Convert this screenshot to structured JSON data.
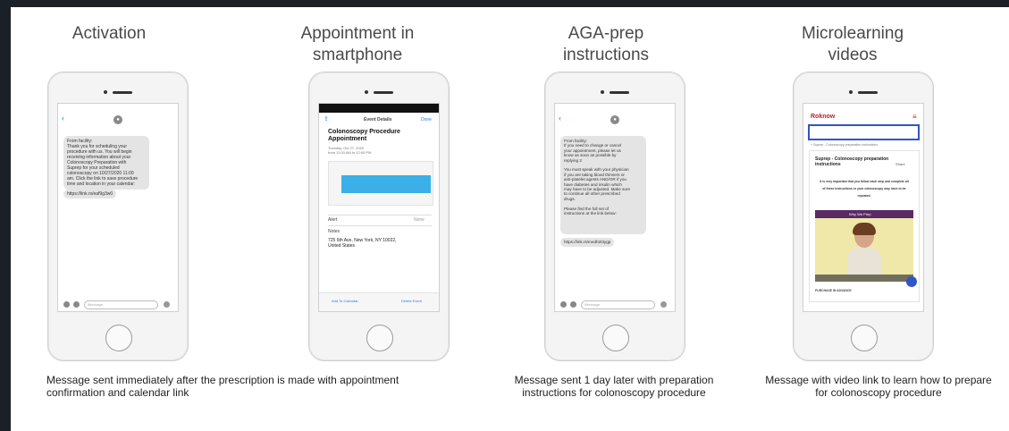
{
  "columns": [
    {
      "title": "Activation"
    },
    {
      "title": "Appointment in\nsmartphone"
    },
    {
      "title": "AGA-prep\ninstructions"
    },
    {
      "title": "Microlearning\nvideos"
    }
  ],
  "captions": {
    "left": "Message sent immediately after the prescription is made with appointment\nconfirmation and calendar link",
    "middle": "Message sent 1 day later with preparation\ninstructions for colonoscopy procedure",
    "right": "Message with video link to learn how to prepare\nfor colonoscopy procedure"
  },
  "phone1": {
    "message": "From facility:\nThank you for scheduling your\nprocedure with us. You will begin\nreceiving information about your\nColonoscopy Preparation with\nSuprep for your scheduled\ncolonoscopy on 10/27/2020 11:00\nam. Click the link to save procedure\ntime and location in your calendar:",
    "link": "https://link.rs/eaf9g3w0",
    "input_placeholder": "iMessage"
  },
  "phone2": {
    "nav_title": "Event Details",
    "nav_done": "Done",
    "event_title": "Colonoscopy Procedure\nAppointment",
    "event_meta": "Tuesday, Oct 27, 2020\nfrom 11:00 AM to 12:00 PM",
    "alert_label": "Alert",
    "alert_value": "None",
    "notes_label": "Notes",
    "notes_value": "725 6th Ave, New York, NY 10022,\nUnited States",
    "add_label": "Add To Calendar",
    "delete_label": "Delete Event",
    "event_color": "#3bb0e8"
  },
  "phone3": {
    "message": "From facility:\nIf you need to change or cancel\nyour appointment, please let us\nknow as soon as possible by\nreplying 2\n\nYou must speak with your physician\nif you are taking blood thinners or\nanti-platelet agents AND/OR if you\nhave diabetes and insulin which\nmay have to be adjusted. Make sure\nto continue all other prescribed\ndrugs.\n\nPlease find the full set of\ninstructions at the link below:",
    "link": "https://link.rs/medh2t3ygp",
    "input_placeholder": "iMessage"
  },
  "phone4": {
    "logo": "Roknow",
    "breadcrumb": "< Suprep - Colonoscopy preparation instructions",
    "card_title": "Suprep - Colonoscopy preparation\ninstructions",
    "share_label": "Share",
    "body_text": "It is very important that you follow each step and complete all\nof these instructions or your colonoscopy may have to be\nrepeated.",
    "video_banner": "Why We Prep",
    "footer_label": "PURCHASE IN ADVANCE",
    "accent_color": "#2f56c7",
    "video_bg": "#efe8a8",
    "banner_color": "#5a2a66"
  }
}
